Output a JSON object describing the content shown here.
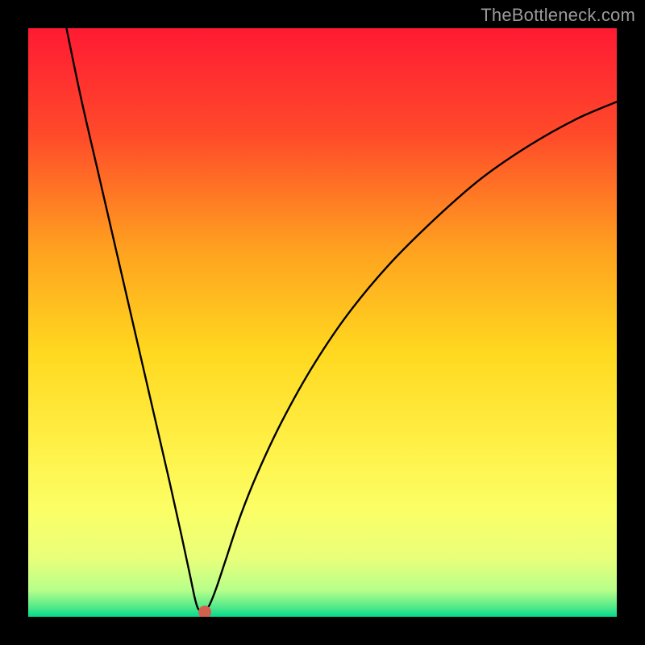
{
  "watermark": "TheBottleneck.com",
  "chart_data": {
    "type": "line",
    "title": "",
    "xlabel": "",
    "ylabel": "",
    "xlim": [
      0,
      1
    ],
    "ylim": [
      0,
      1
    ],
    "gradient_stops": [
      {
        "offset": 0.0,
        "color": "#ff1a33"
      },
      {
        "offset": 0.18,
        "color": "#ff4a2a"
      },
      {
        "offset": 0.38,
        "color": "#ffa31f"
      },
      {
        "offset": 0.55,
        "color": "#ffd81f"
      },
      {
        "offset": 0.72,
        "color": "#fff24a"
      },
      {
        "offset": 0.82,
        "color": "#fbff66"
      },
      {
        "offset": 0.9,
        "color": "#e9ff7a"
      },
      {
        "offset": 0.955,
        "color": "#b7ff8a"
      },
      {
        "offset": 0.985,
        "color": "#4de88a"
      },
      {
        "offset": 1.0,
        "color": "#00d98c"
      }
    ],
    "series": [
      {
        "name": "bottleneck-curve",
        "comment": "y=0 is top of gradient, y=1 is bottom (green). Minimum (zero bottleneck) at x≈0.295.",
        "points": [
          {
            "x": 0.065,
            "y": 0.0
          },
          {
            "x": 0.09,
            "y": 0.12
          },
          {
            "x": 0.12,
            "y": 0.25
          },
          {
            "x": 0.15,
            "y": 0.38
          },
          {
            "x": 0.18,
            "y": 0.51
          },
          {
            "x": 0.21,
            "y": 0.64
          },
          {
            "x": 0.24,
            "y": 0.77
          },
          {
            "x": 0.26,
            "y": 0.86
          },
          {
            "x": 0.275,
            "y": 0.93
          },
          {
            "x": 0.283,
            "y": 0.968
          },
          {
            "x": 0.288,
            "y": 0.985
          },
          {
            "x": 0.293,
            "y": 0.99
          },
          {
            "x": 0.3,
            "y": 0.99
          },
          {
            "x": 0.308,
            "y": 0.98
          },
          {
            "x": 0.32,
            "y": 0.95
          },
          {
            "x": 0.335,
            "y": 0.905
          },
          {
            "x": 0.36,
            "y": 0.83
          },
          {
            "x": 0.39,
            "y": 0.755
          },
          {
            "x": 0.43,
            "y": 0.67
          },
          {
            "x": 0.48,
            "y": 0.58
          },
          {
            "x": 0.54,
            "y": 0.49
          },
          {
            "x": 0.61,
            "y": 0.405
          },
          {
            "x": 0.69,
            "y": 0.325
          },
          {
            "x": 0.77,
            "y": 0.255
          },
          {
            "x": 0.85,
            "y": 0.2
          },
          {
            "x": 0.93,
            "y": 0.155
          },
          {
            "x": 1.0,
            "y": 0.125
          }
        ]
      }
    ],
    "marker": {
      "x": 0.3,
      "y": 0.992,
      "color": "#d1604f",
      "radius_px": 8
    }
  }
}
